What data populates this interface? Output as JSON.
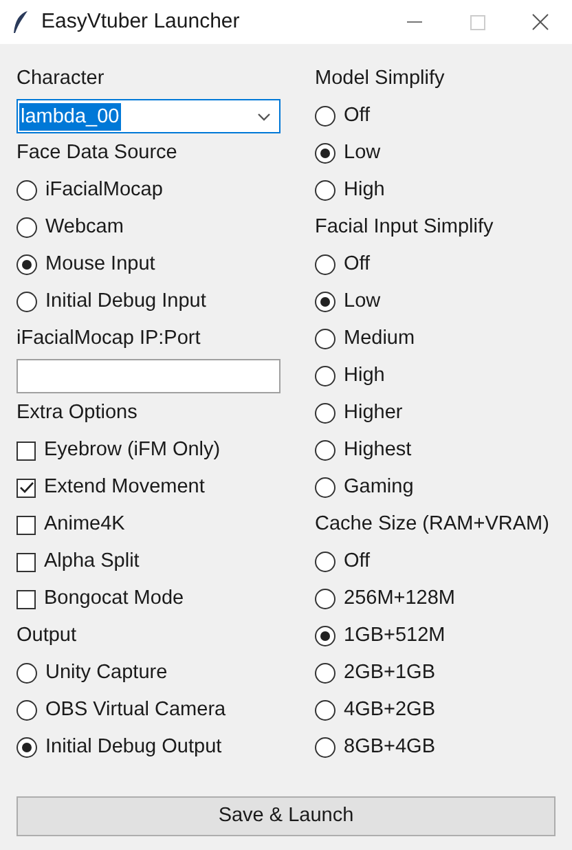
{
  "window": {
    "title": "EasyVtuber Launcher"
  },
  "columns": [
    [
      {
        "label": "Character",
        "kind": "dropdown",
        "value": "lambda_00"
      },
      {
        "label": "Face Data Source",
        "kind": "radio",
        "options": [
          {
            "label": "iFacialMocap",
            "selected": false
          },
          {
            "label": "Webcam",
            "selected": false
          },
          {
            "label": "Mouse Input",
            "selected": true
          },
          {
            "label": "Initial Debug Input",
            "selected": false
          }
        ]
      },
      {
        "label": "iFacialMocap IP:Port",
        "kind": "text"
      },
      {
        "label": "Extra Options",
        "kind": "checkbox",
        "options": [
          {
            "label": "Eyebrow (iFM Only)",
            "checked": false
          },
          {
            "label": "Extend Movement",
            "checked": true
          },
          {
            "label": "Anime4K",
            "checked": false
          },
          {
            "label": "Alpha Split",
            "checked": false
          },
          {
            "label": "Bongocat Mode",
            "checked": false
          }
        ]
      },
      {
        "label": "Output",
        "kind": "radio",
        "options": [
          {
            "label": "Unity Capture",
            "selected": false
          },
          {
            "label": "OBS Virtual Camera",
            "selected": false
          },
          {
            "label": "Initial Debug Output",
            "selected": true
          }
        ]
      }
    ],
    [
      {
        "label": "Model Simplify",
        "kind": "radio",
        "options": [
          {
            "label": "Off",
            "selected": false
          },
          {
            "label": "Low",
            "selected": true
          },
          {
            "label": "High",
            "selected": false
          }
        ]
      },
      {
        "label": "Facial Input Simplify",
        "kind": "radio",
        "options": [
          {
            "label": "Off",
            "selected": false
          },
          {
            "label": "Low",
            "selected": true
          },
          {
            "label": "Medium",
            "selected": false
          },
          {
            "label": "High",
            "selected": false
          },
          {
            "label": "Higher",
            "selected": false
          },
          {
            "label": "Highest",
            "selected": false
          },
          {
            "label": "Gaming",
            "selected": false
          }
        ]
      },
      {
        "label": "Cache Size (RAM+VRAM)",
        "kind": "radio",
        "options": [
          {
            "label": "Off",
            "selected": false
          },
          {
            "label": "256M+128M",
            "selected": false
          },
          {
            "label": "1GB+512M",
            "selected": true
          },
          {
            "label": "2GB+1GB",
            "selected": false
          },
          {
            "label": "4GB+2GB",
            "selected": false
          },
          {
            "label": "8GB+4GB",
            "selected": false
          }
        ]
      }
    ]
  ],
  "button": {
    "label": "Save & Launch"
  }
}
